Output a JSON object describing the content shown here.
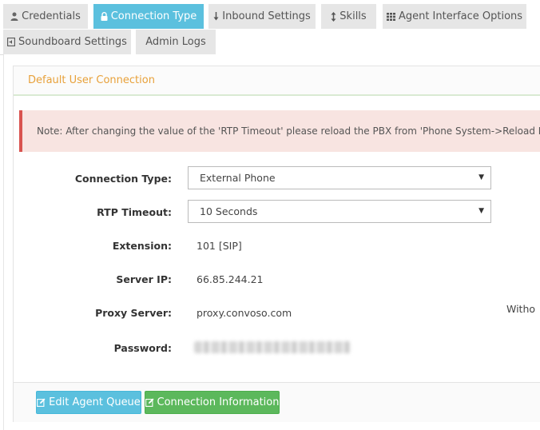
{
  "tabs": [
    {
      "label": "Credentials",
      "icon": "user-icon",
      "active": false
    },
    {
      "label": "Connection Type",
      "icon": "lock-icon",
      "active": true
    },
    {
      "label": "Inbound Settings",
      "icon": "arrow-down-icon",
      "active": false
    },
    {
      "label": "Skills",
      "icon": "vertical-arrows-icon",
      "active": false
    },
    {
      "label": "Agent Interface Options",
      "icon": "grid-icon",
      "active": false
    },
    {
      "label": "Soundboard Settings",
      "icon": "file-audio-icon",
      "active": false
    },
    {
      "label": "Admin Logs",
      "icon": "",
      "active": false
    }
  ],
  "panel": {
    "title": "Default User Connection",
    "note": "Note: After changing the value of the 'RTP Timeout' please reload the PBX from 'Phone System->Reload PBX'."
  },
  "form": {
    "connection_type": {
      "label": "Connection Type:",
      "value": "External Phone"
    },
    "rtp_timeout": {
      "label": "RTP Timeout:",
      "value": "10 Seconds"
    },
    "extension": {
      "label": "Extension:",
      "value": "101 [SIP]"
    },
    "server_ip": {
      "label": "Server IP:",
      "value": "66.85.244.21"
    },
    "proxy_server": {
      "label": "Proxy Server:",
      "value": "proxy.convoso.com"
    },
    "password": {
      "label": "Password:"
    },
    "truncated_text": "Witho"
  },
  "buttons": {
    "edit_queue": "Edit Agent Queue",
    "connection_info": "Connection Information"
  },
  "colors": {
    "active_tab": "#5bc0de",
    "inactive_tab": "#e6e6e6",
    "panel_title": "#e8a13a",
    "note_bg": "#f8e4e1",
    "note_border": "#d9534f",
    "btn_info": "#5bc0de",
    "btn_success": "#5cb85c"
  }
}
